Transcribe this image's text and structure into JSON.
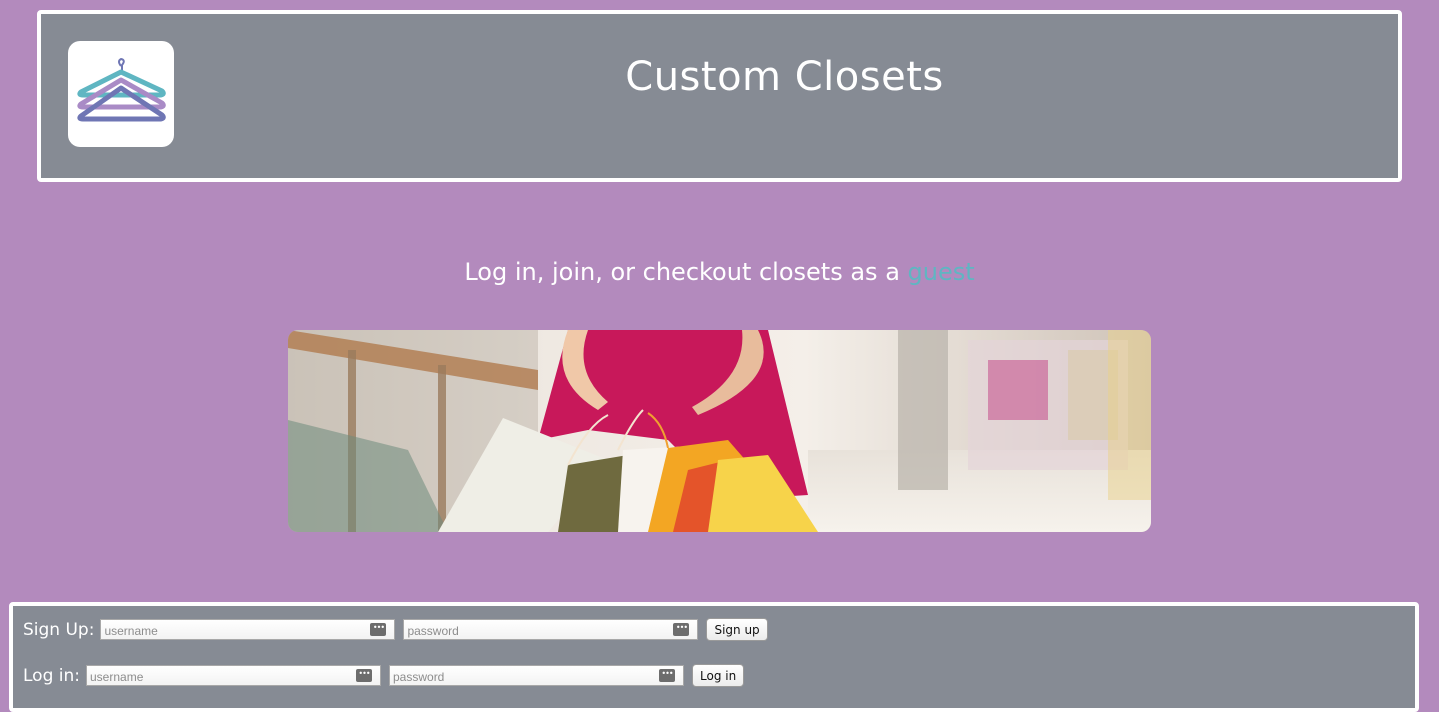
{
  "header": {
    "title": "Custom Closets",
    "logo_icon": "clothes-hanger-icon",
    "colors": {
      "bar": "#868b94",
      "hanger_teal": "#5fb6c2",
      "hanger_purple": "#a98bc6",
      "hanger_blue": "#6f76b4"
    }
  },
  "intro": {
    "text": "Log in, join, or checkout closets as a ",
    "guest_link": "guest"
  },
  "hero": {
    "description_icon": "shopping-bags-photo"
  },
  "signup": {
    "label": "Sign Up:",
    "username_placeholder": "username",
    "password_placeholder": "password",
    "button": "Sign up"
  },
  "login": {
    "label": "Log in:",
    "username_placeholder": "username",
    "password_placeholder": "password",
    "button": "Log in"
  },
  "colors": {
    "background": "#b38abd",
    "guest_link": "#5fb6c2"
  }
}
